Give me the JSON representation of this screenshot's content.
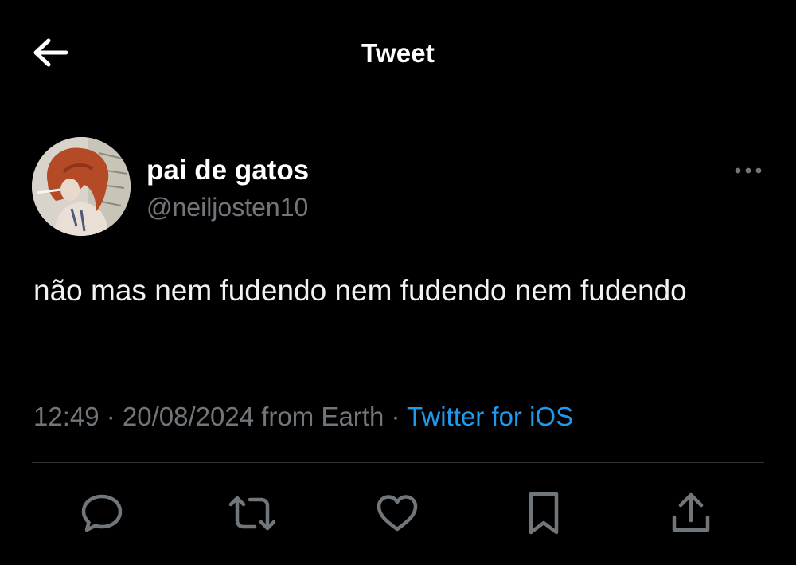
{
  "header": {
    "back_icon": "arrow-left-icon",
    "title": "Tweet"
  },
  "tweet": {
    "author": {
      "display_name": "pai de gatos",
      "handle": "@neiljosten10",
      "avatar_icon": "profile-photo"
    },
    "more_icon": "more-horizontal-icon",
    "text": "não mas nem fudendo nem fudendo nem fudendo",
    "meta": {
      "time": "12:49",
      "separator_1": " · ",
      "date": "20/08/2024",
      "location": " from Earth",
      "separator_2": " · ",
      "source": "Twitter for iOS"
    },
    "actions": [
      {
        "name": "reply",
        "icon": "reply-icon"
      },
      {
        "name": "retweet",
        "icon": "retweet-icon"
      },
      {
        "name": "like",
        "icon": "heart-icon"
      },
      {
        "name": "bookmark",
        "icon": "bookmark-icon"
      },
      {
        "name": "share",
        "icon": "share-icon"
      }
    ]
  },
  "colors": {
    "background": "#000000",
    "primary_text": "#e7e9ea",
    "secondary_text": "#71767b",
    "link": "#1d9bf0",
    "divider": "#2f3336",
    "icon": "#71767b"
  }
}
